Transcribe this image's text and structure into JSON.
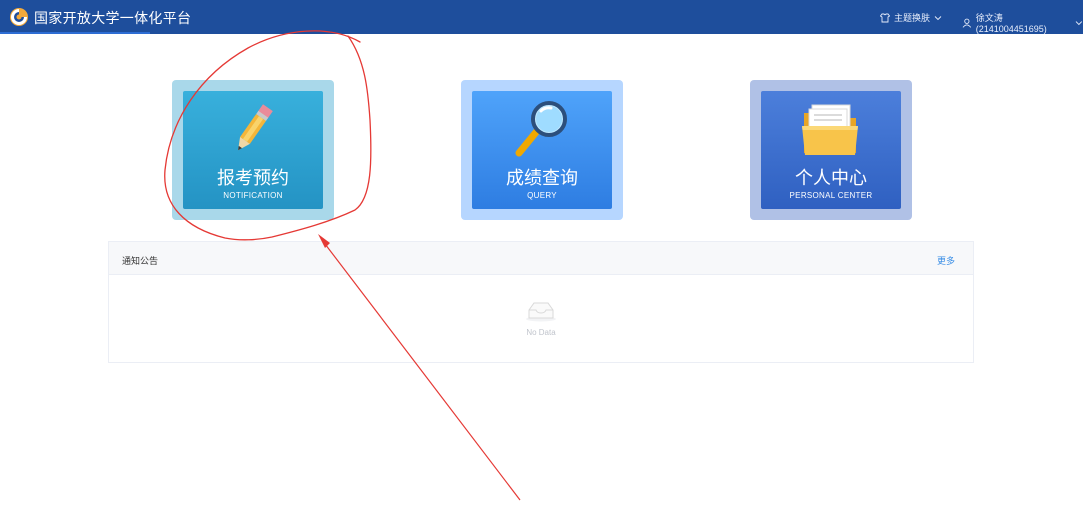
{
  "header": {
    "title": "国家开放大学一体化平台",
    "theme_label": "主题换肤",
    "user_label": "徐文涛(2141004451695)"
  },
  "tiles": [
    {
      "title": "报考预约",
      "subtitle": "NOTIFICATION",
      "icon": "pencil-icon"
    },
    {
      "title": "成绩查询",
      "subtitle": "QUERY",
      "icon": "magnifier-icon"
    },
    {
      "title": "个人中心",
      "subtitle": "PERSONAL CENTER",
      "icon": "folder-icon"
    }
  ],
  "notice": {
    "title": "通知公告",
    "more_label": "更多",
    "empty_text": "No Data"
  },
  "colors": {
    "header_bg": "#1e4e9c",
    "annotation": "#e53935",
    "link": "#3a8ee6"
  }
}
